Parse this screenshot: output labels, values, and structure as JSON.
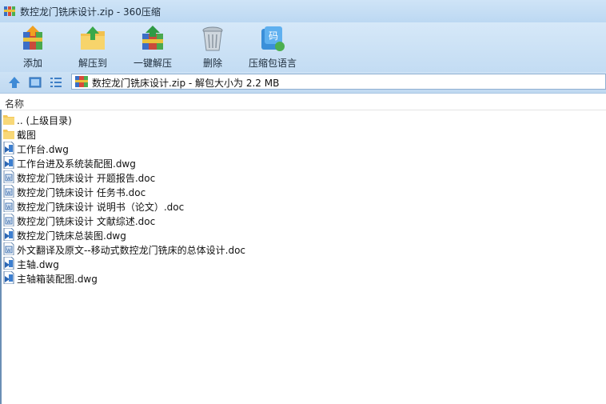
{
  "window": {
    "title": "数控龙门铣床设计.zip - 360压缩"
  },
  "toolbar": {
    "items": [
      {
        "label": "添加",
        "icon": "add-archive-icon"
      },
      {
        "label": "解压到",
        "icon": "extract-to-folder-icon"
      },
      {
        "label": "一键解压",
        "icon": "one-click-extract-icon"
      },
      {
        "label": "删除",
        "icon": "trash-icon"
      },
      {
        "label": "压缩包语言",
        "icon": "archive-language-icon"
      }
    ]
  },
  "address": {
    "path": "数控龙门铣床设计.zip - 解包大小为 2.2 MB"
  },
  "list": {
    "column_name": "名称",
    "files": [
      {
        "name": ".. (上级目录)",
        "type": "folder"
      },
      {
        "name": "截图",
        "type": "folder"
      },
      {
        "name": "工作台.dwg",
        "type": "dwg"
      },
      {
        "name": "工作台进及系统装配图.dwg",
        "type": "dwg"
      },
      {
        "name": "数控龙门铣床设计 开题报告.doc",
        "type": "doc"
      },
      {
        "name": "数控龙门铣床设计 任务书.doc",
        "type": "doc"
      },
      {
        "name": "数控龙门铣床设计 说明书（论文）.doc",
        "type": "doc"
      },
      {
        "name": "数控龙门铣床设计 文献综述.doc",
        "type": "doc"
      },
      {
        "name": "数控龙门铣床总装图.dwg",
        "type": "dwg"
      },
      {
        "name": "外文翻译及原文--移动式数控龙门铣床的总体设计.doc",
        "type": "doc"
      },
      {
        "name": "主轴.dwg",
        "type": "dwg"
      },
      {
        "name": "主轴箱装配图.dwg",
        "type": "dwg"
      }
    ]
  }
}
